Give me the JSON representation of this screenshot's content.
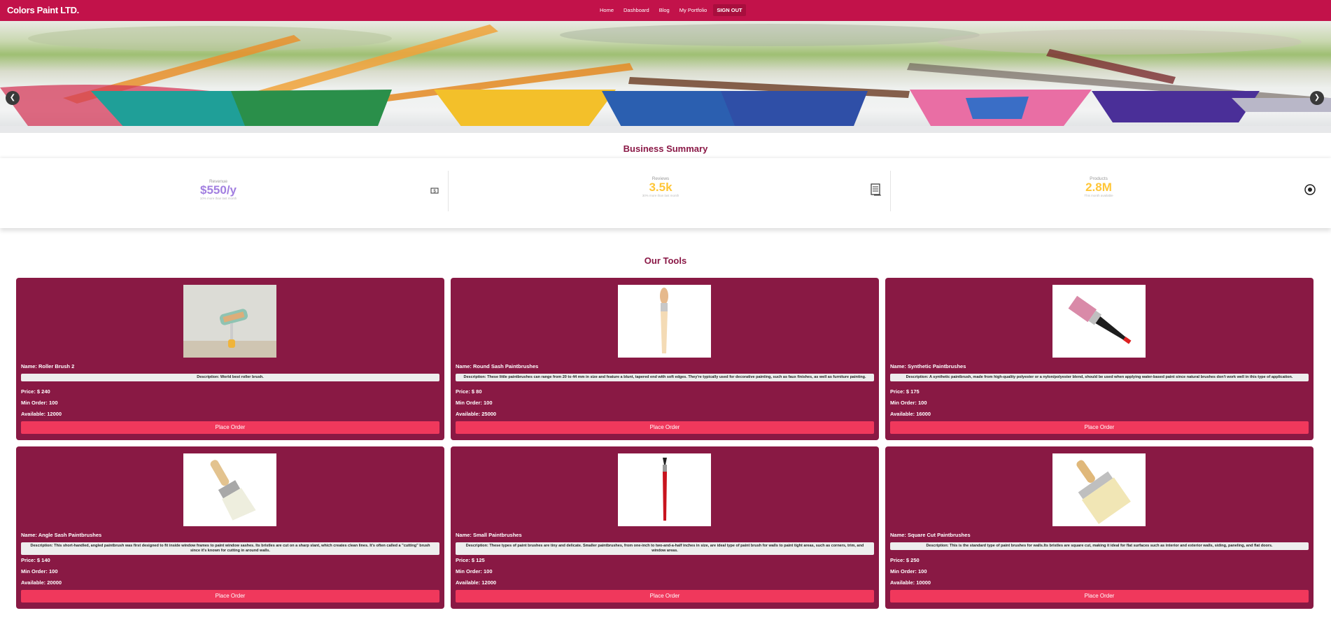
{
  "brand": "Colors Paint LTD.",
  "nav": {
    "home": "Home",
    "dashboard": "Dashboard",
    "blog": "Blog",
    "portfolio": "My Portfolio",
    "signout": "SIGN OUT"
  },
  "carousel": {
    "prev_icon": "chevron-left",
    "next_icon": "chevron-right"
  },
  "summary": {
    "title": "Business Summary",
    "stats": [
      {
        "label": "Revenue",
        "value": "$550/y",
        "sub": "10% more than last month",
        "color": "#a27fe0",
        "icon": "dollar-icon"
      },
      {
        "label": "Reviews",
        "value": "3.5k",
        "sub": "30% more than last month",
        "color": "#ffc637",
        "icon": "document-icon"
      },
      {
        "label": "Products",
        "value": "2.8M",
        "sub": "This month available",
        "color": "#ffc637",
        "icon": "globe-icon"
      }
    ]
  },
  "tools": {
    "title": "Our Tools",
    "items": [
      {
        "name": "Name: Roller Brush 2",
        "description": "Description: World best roller brush.",
        "price": "Price: $ 240",
        "min_order": "Min Order: 100",
        "available": "Available: 12000",
        "button": "Place Order"
      },
      {
        "name": "Name: Round Sash Paintbrushes",
        "description": "Description: These little paintbrushes can range from 20 to 44 mm in size and feature a blunt, tapered end with soft edges. They're typically used for decorative painting, such as faux finishes, as well as furniture painting.",
        "price": "Price: $ 80",
        "min_order": "Min Order: 100",
        "available": "Available: 25000",
        "button": "Place Order"
      },
      {
        "name": "Name: Synthetic Paintbrushes",
        "description": "Description: A synthetic paintbrush, made from high-quality polyester or a nylon/polyester blend, should be used when applying water-based paint since natural brushes don't work well in this type of application.",
        "price": "Price: $ 175",
        "min_order": "Min Order: 100",
        "available": "Available: 16000",
        "button": "Place Order"
      },
      {
        "name": "Name: Angle Sash Paintbrushes",
        "description": "Description: This short-handled, angled paintbrush was first designed to fit inside window frames to paint window sashes. Its bristles are cut on a sharp slant, which creates clean lines. It's often called a \"cutting\" brush since it's known for cutting in around walls.",
        "price": "Price: $ 140",
        "min_order": "Min Order: 100",
        "available": "Available: 20000",
        "button": "Place Order"
      },
      {
        "name": "Name: Small Paintbrushes",
        "description": "Description: These types of paint brushes are tiny and delicate. Smaller paintbrushes, from one-inch to two-and-a-half inches in size, are ideal type of paint brush for walls to paint tight areas, such as corners, trim, and window areas.",
        "price": "Price: $ 125",
        "min_order": "Min Order: 100",
        "available": "Available: 12000",
        "button": "Place Order"
      },
      {
        "name": "Name: Square Cut Paintbrushes",
        "description": "Description: This is the standard type of paint brushes for walls.Its bristles are square cut, making it ideal for flat surfaces such as interior and exterior walls, siding, paneling, and flat doors.",
        "price": "Price: $ 250",
        "min_order": "Min Order: 100",
        "available": "Available: 10000",
        "button": "Place Order"
      }
    ]
  }
}
